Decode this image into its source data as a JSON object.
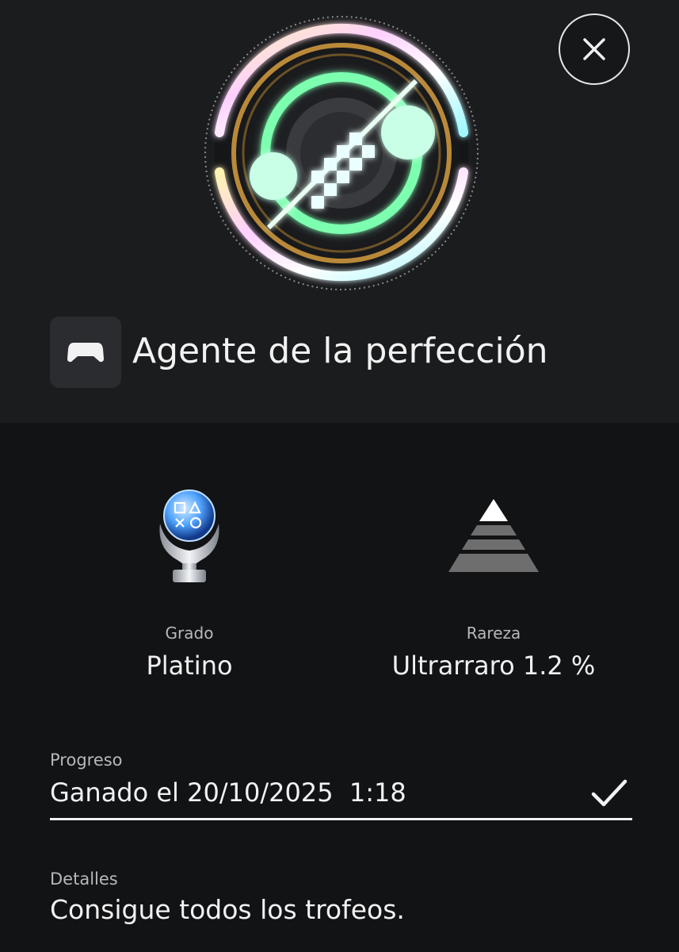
{
  "header": {
    "trophy_name": "Agente de la perfección",
    "close_icon": "close-icon",
    "game_icon": "gamepad-icon"
  },
  "stats": {
    "grade": {
      "label": "Grado",
      "value": "Platino",
      "icon": "platinum-trophy-icon"
    },
    "rarity": {
      "label": "Rareza",
      "value": "Ultrarraro 1.2 %",
      "icon": "rarity-pyramid-icon"
    }
  },
  "progress": {
    "label": "Progreso",
    "value": "Ganado el 20/10/2025  1:18",
    "status_icon": "checkmark-icon"
  },
  "details": {
    "label": "Detalles",
    "text": "Consigue todos los trofeos."
  },
  "colors": {
    "background": "#121315",
    "header_background": "#1b1c1e",
    "neon_green": "#7dffb0",
    "gold_ring": "#b9893a",
    "platinum_blue": "#4fa3ff"
  }
}
